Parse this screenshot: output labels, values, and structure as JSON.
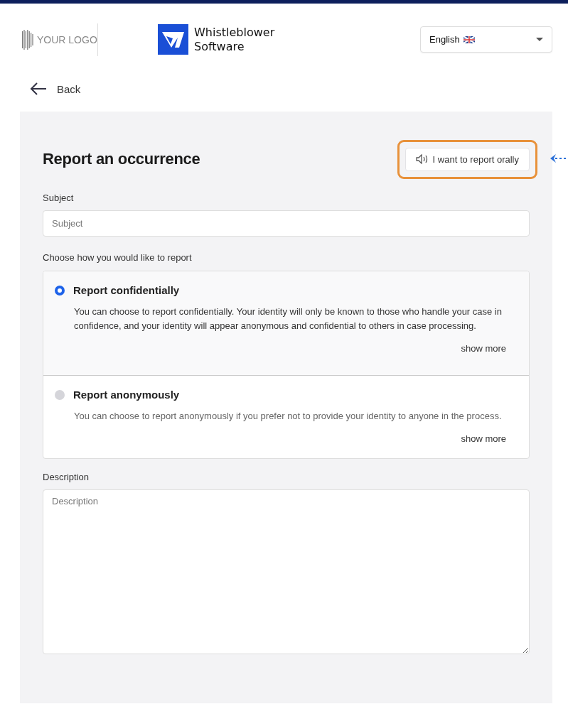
{
  "header": {
    "client_logo": "YOUR LOGO",
    "brand": {
      "line1": "Whistleblower",
      "line2": "Software"
    },
    "language": {
      "value": "English",
      "flag": true
    }
  },
  "back": {
    "label": "Back"
  },
  "form": {
    "title": "Report an occurrence",
    "oral_button": {
      "label": "I want to report orally",
      "highlighted": true
    },
    "subject": {
      "label": "Subject",
      "placeholder": "Subject"
    },
    "choice_label": "Choose how you would like to report",
    "options": [
      {
        "title": "Report confidentially",
        "text": "You can choose to report confidentially. Your identity will only be known to those who handle your case in confidence, and your identity will appear anonymous and confidential to others in case processing.",
        "more": "show more",
        "selected": true
      },
      {
        "title": "Report anonymously",
        "text": "You can choose to report anonymously if you prefer not to provide your identity to anyone in the process.",
        "more": "show more",
        "selected": false
      }
    ],
    "description": {
      "label": "Description",
      "placeholder": "Description"
    }
  }
}
